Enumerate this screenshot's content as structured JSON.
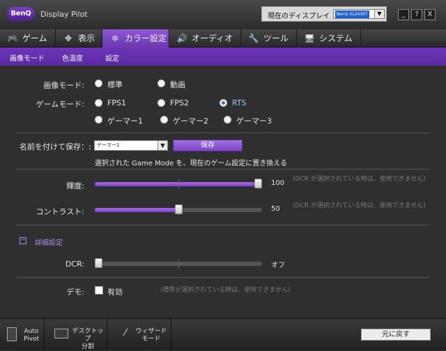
{
  "app": {
    "logo": "BenQ",
    "title": "Display Pilot"
  },
  "display": {
    "label": "現在のディスプレイ",
    "selected": "BenQ XL2430T"
  },
  "window_controls": [
    "_",
    "?",
    "X"
  ],
  "tabs": [
    {
      "icon": "gamepad-icon",
      "label": "ゲーム"
    },
    {
      "icon": "display-icon",
      "label": "表示"
    },
    {
      "icon": "color-icon",
      "label": "カラー設定"
    },
    {
      "icon": "speaker-icon",
      "label": "オーディオ"
    },
    {
      "icon": "wrench-icon",
      "label": "ツール"
    },
    {
      "icon": "system-icon",
      "label": "システム"
    }
  ],
  "subtabs": [
    "画像モード",
    "色温度",
    "設定"
  ],
  "picture_mode": {
    "label": "画像モード:",
    "options": [
      "標準",
      "動画"
    ]
  },
  "game_mode": {
    "label": "ゲームモード:",
    "row1": [
      "FPS1",
      "FPS2",
      "RTS"
    ],
    "row2": [
      "ゲーマー1",
      "ゲーマー2",
      "ゲーマー3"
    ],
    "selected": "RTS"
  },
  "save": {
    "label": "名前を付けて保存：:",
    "combo_value": "ゲーマー1",
    "button": "保存",
    "note": "選択された Game Mode を、現在のゲーム設定に置き換える"
  },
  "brightness": {
    "label": "輝度:",
    "value": 100,
    "max": 100,
    "note": "(DCR が選択されている時は、使用できません)"
  },
  "contrast": {
    "label": "コントラスト:",
    "value": 50,
    "max": 100,
    "note": "(DCR が選択されている時は、使用できません)"
  },
  "advanced": {
    "toggle": "−",
    "label": "詳細設定"
  },
  "dcr": {
    "label": "DCR:",
    "value": 0,
    "value_text": "オフ"
  },
  "demo": {
    "label": "デモ:",
    "checkbox_label": "有効",
    "checked": false,
    "note": "(標準が選択されている時は、使用できません)"
  },
  "footer": {
    "auto_pivot": {
      "line1": "Auto",
      "line2": "Pivot"
    },
    "desktop_split": {
      "line1": "デスクトップ",
      "line2": "分割"
    },
    "wizard": {
      "line1": "ウィザード",
      "line2": "モード"
    },
    "back": "元に戻す"
  },
  "colors": {
    "accent": "#7b40c6",
    "selected_radio": "#8fd0ff"
  }
}
